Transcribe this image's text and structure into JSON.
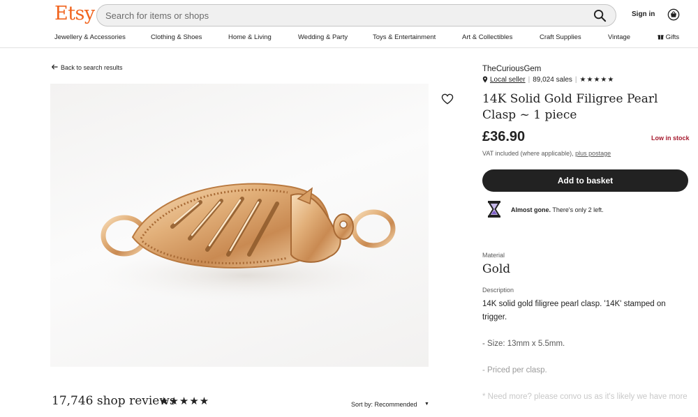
{
  "header": {
    "logo": "Etsy",
    "search_placeholder": "Search for items or shops",
    "sign_in": "Sign in"
  },
  "nav": {
    "items": [
      "Jewellery & Accessories",
      "Clothing & Shoes",
      "Home & Living",
      "Wedding & Party",
      "Toys & Entertainment",
      "Art & Collectibles",
      "Craft Supplies",
      "Vintage",
      "Gifts"
    ]
  },
  "left": {
    "back_link": "Back to search results",
    "reviews_count": "17,746 shop reviews",
    "review_stars": "★★★★★",
    "sort_label": "Sort by: Recommended"
  },
  "product": {
    "shop_name": "TheCuriousGem",
    "local_seller": "Local seller",
    "sales": "89,024 sales",
    "rating_stars": "★★★★★",
    "title": "14K Solid Gold Filigree Pearl Clasp ~ 1 piece",
    "price": "£36.90",
    "stock_status": "Low in stock",
    "vat_text": "VAT included (where applicable),",
    "vat_link": "plus postage",
    "add_to_basket": "Add to basket",
    "almost_gone_bold": "Almost gone.",
    "almost_gone_rest": "There's only 2 left.",
    "material_label": "Material",
    "material_value": "Gold",
    "description_label": "Description",
    "description_line1": "14K solid gold filigree pearl clasp. '14K' stamped on trigger.",
    "description_line2": "- Size: 13mm x 5.5mm.",
    "description_line3": "- Priced per clasp.",
    "description_line4": "* Need more? please convo us as it's likely we have more"
  },
  "colors": {
    "brand": "#f1641e",
    "button": "#222222",
    "low_stock": "#a61a2e"
  },
  "icons": [
    "search-icon",
    "basket-icon",
    "gift-icon",
    "back-arrow-icon",
    "heart-icon",
    "pin-icon",
    "hourglass-icon",
    "caret-down-icon"
  ]
}
